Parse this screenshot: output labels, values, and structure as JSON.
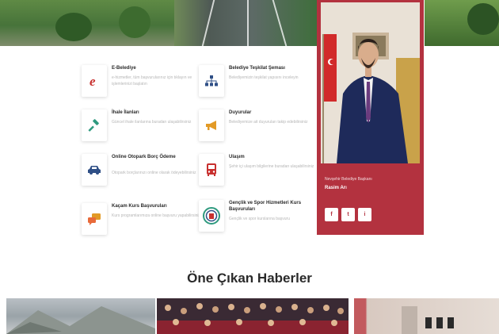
{
  "services": [
    {
      "title": "E-Belediye",
      "desc": "e-hizmetler, tüm başvurularınız için tıklayın ve işlemlerinizi başlatın"
    },
    {
      "title": "Belediye Teşkilat Şeması",
      "desc": "Belediyemizin teşkilat yapısını inceleyin"
    },
    {
      "title": "İhale İlanları",
      "desc": "Güncel ihale ilanlarına buradan ulaşabilirsiniz"
    },
    {
      "title": "Duyurular",
      "desc": "Belediyemize ait duyuruları takip edebilirsiniz"
    },
    {
      "title": "Online Otopark Borç Ödeme",
      "desc": "Otopark borçlarınızı online olarak ödeyebilirsiniz"
    },
    {
      "title": "Ulaşım",
      "desc": "Şehir içi ulaşım bilgilerine buradan ulaşabilirsiniz"
    },
    {
      "title": "Kaçam Kurs Başvuruları",
      "desc": "Kurs programlarımıza online başvuru yapabilirsiniz"
    },
    {
      "title": "Gençlik ve Spor Hizmetleri Kurs Başvuruları",
      "desc": "Gençlik ve spor kurslarına başvuru"
    }
  ],
  "mayor": {
    "subtitle": "Nevşehir Belediye Başkanı",
    "name": "Rasim Arı",
    "social": [
      "f",
      "t",
      "i"
    ]
  },
  "news": {
    "title": "Öne Çıkan Haberler"
  },
  "colors": {
    "accent": "#b3323f",
    "icon_red": "#c8302f",
    "icon_blue": "#2f4f86",
    "icon_green": "#2f9a7f",
    "icon_orange": "#e29a26"
  },
  "icons": [
    "e-belediye-icon",
    "org-chart-icon",
    "gavel-icon",
    "megaphone-icon",
    "car-icon",
    "bus-icon",
    "chat-icon",
    "sports-logo-icon"
  ]
}
